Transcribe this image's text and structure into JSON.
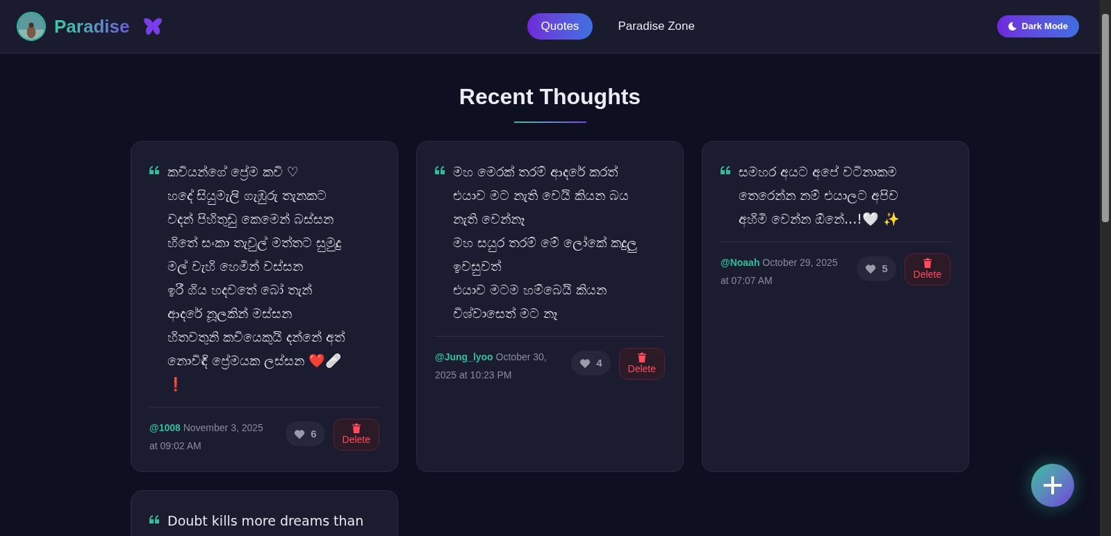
{
  "header": {
    "brand": "Paradise",
    "nav": [
      {
        "label": "Quotes",
        "selected": true
      },
      {
        "label": "Paradise Zone",
        "selected": false
      }
    ],
    "theme_button": "Dark Mode"
  },
  "heading": "Recent Thoughts",
  "quotes": [
    {
      "text": "කවියන්ගේ ප්‍රේම කවි ♡\nහදේ සියුමැලි ගැඹුරු තැනකට\nවදන් පිහිතුඩු කෙමෙන් බස්සන\nහිතේ සංකා තැවුල් මත්තට සුමුදු\nමල් වැහි හෙමින් වස්සන\nඉරී ගිය හදවතේ බෝ තැන්\nආදරේ නූලකින් මස්සන\nහිතවතුනි කවියෙකුයි දන්නේ අත්\nනොවිඳි ප්‍රේමයක ලස්සන ❤️🩹\n❗",
      "author": "@1008",
      "date": "November 3, 2025",
      "time": "at 09:02 AM",
      "likes": "6",
      "delete": "Delete"
    },
    {
      "text": "මහ මෙරක් තරම් ආදරේ කරත්\nඑයාව මට නැති වෙයි කියන බය\nනැති වෙන්නෑ\nමහ සයුර තරම් මේ ලෝකේ කදුලු\nඉවසුවත්\nඑයාව මටම හම්බෙයි කියන\nවිශ්වාසෙත් මට නෑ",
      "author": "@Jung_lyoo",
      "date": "October 30,",
      "time": "2025 at 10:23 PM",
      "likes": "4",
      "delete": "Delete"
    },
    {
      "text": "සමහර අයට අපේ වටිනාකම\nතෙරෙන්න නම් එයාලට අපිව\nඅහිමි වෙන්න ඕනේ...!🤍 ✨",
      "author": "@Noaah",
      "date": "October 29, 2025",
      "time": "at 07:07 AM",
      "likes": "5",
      "delete": "Delete"
    },
    {
      "text": "Doubt kills more dreams than"
    }
  ]
}
